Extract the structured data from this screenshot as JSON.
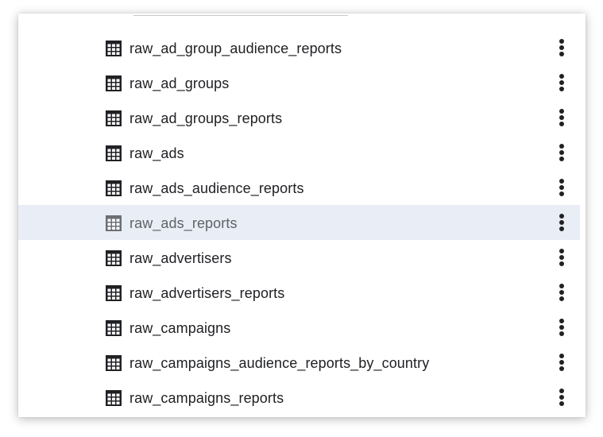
{
  "tables": {
    "items": [
      {
        "name": "raw_ad_group_audience_reports",
        "icon": "table-icon",
        "selected": false
      },
      {
        "name": "raw_ad_groups",
        "icon": "table-icon",
        "selected": false
      },
      {
        "name": "raw_ad_groups_reports",
        "icon": "table-icon",
        "selected": false
      },
      {
        "name": "raw_ads",
        "icon": "table-icon",
        "selected": false
      },
      {
        "name": "raw_ads_audience_reports",
        "icon": "table-icon",
        "selected": false
      },
      {
        "name": "raw_ads_reports",
        "icon": "table-icon",
        "selected": true
      },
      {
        "name": "raw_advertisers",
        "icon": "table-icon",
        "selected": false
      },
      {
        "name": "raw_advertisers_reports",
        "icon": "table-icon",
        "selected": false
      },
      {
        "name": "raw_campaigns",
        "icon": "table-icon",
        "selected": false
      },
      {
        "name": "raw_campaigns_audience_reports_by_country",
        "icon": "table-icon",
        "selected": false
      },
      {
        "name": "raw_campaigns_reports",
        "icon": "table-icon",
        "selected": false
      }
    ],
    "row_action_icon": "more-vert-icon"
  },
  "colors": {
    "selected_row_background": "#e8edf6",
    "text": "#202124",
    "selected_text": "#5f6368"
  }
}
